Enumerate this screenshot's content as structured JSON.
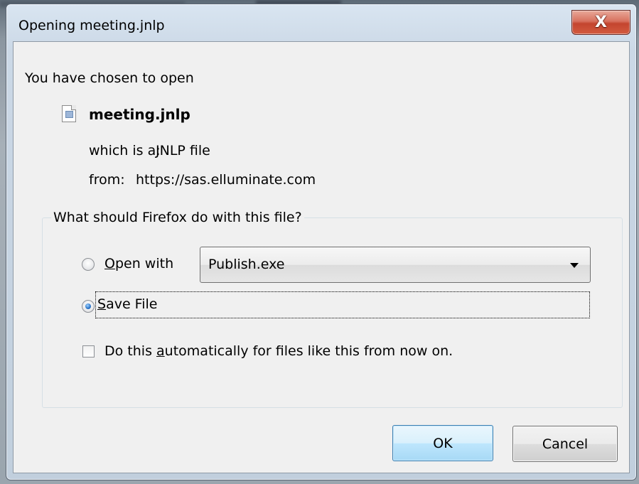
{
  "window": {
    "title": "Opening meeting.jnlp",
    "close_label": "X"
  },
  "info": {
    "intro": "You have chosen to open",
    "filename": "meeting.jnlp",
    "type_label": "which is a:",
    "type_value": "JNLP file",
    "from_label": "from:",
    "from_value": "https://sas.elluminate.com"
  },
  "action_group": {
    "legend": "What should Firefox do with this file?",
    "open_with": {
      "label_accel": "O",
      "label_rest": "pen with",
      "selected": false,
      "app_selected": "Publish.exe"
    },
    "save_file": {
      "label_accel": "S",
      "label_rest": "ave File",
      "selected": true
    },
    "auto_checkbox": {
      "label_pre": "Do this ",
      "label_accel": "a",
      "label_post": "utomatically for files like this from now on.",
      "checked": false
    }
  },
  "buttons": {
    "ok": "OK",
    "cancel": "Cancel"
  },
  "icons": {
    "file": "jnlp-file-icon",
    "close": "close-icon",
    "dropdown": "chevron-down-icon"
  },
  "colors": {
    "close_button": "#c4452f",
    "default_button_border": "#3c7fb1",
    "dialog_background": "#f0f0f0"
  }
}
